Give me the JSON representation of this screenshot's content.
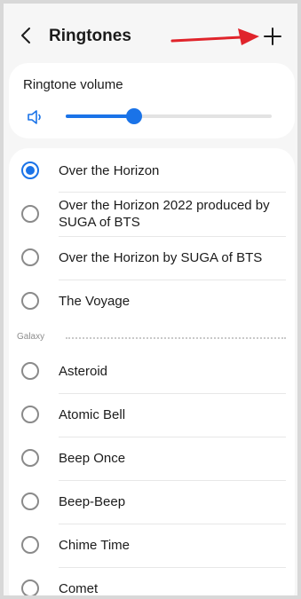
{
  "header": {
    "title": "Ringtones",
    "back_icon": "chevron-left-icon",
    "add_icon": "plus-icon"
  },
  "volume": {
    "label": "Ringtone volume",
    "icon": "speaker-icon",
    "level": 0.33
  },
  "ringtones": {
    "items": [
      {
        "label": "Over the Horizon",
        "selected": true
      },
      {
        "label": "Over the Horizon 2022 produced by SUGA of BTS",
        "selected": false
      },
      {
        "label": "Over the Horizon by SUGA of BTS",
        "selected": false
      },
      {
        "label": "The Voyage",
        "selected": false
      }
    ],
    "section": "Galaxy",
    "galaxy_items": [
      {
        "label": "Asteroid",
        "selected": false
      },
      {
        "label": "Atomic Bell",
        "selected": false
      },
      {
        "label": "Beep Once",
        "selected": false
      },
      {
        "label": "Beep-Beep",
        "selected": false
      },
      {
        "label": "Chime Time",
        "selected": false
      },
      {
        "label": "Comet",
        "selected": false
      }
    ]
  },
  "colors": {
    "accent": "#1a73e8",
    "annotation_arrow": "#e0242b"
  }
}
